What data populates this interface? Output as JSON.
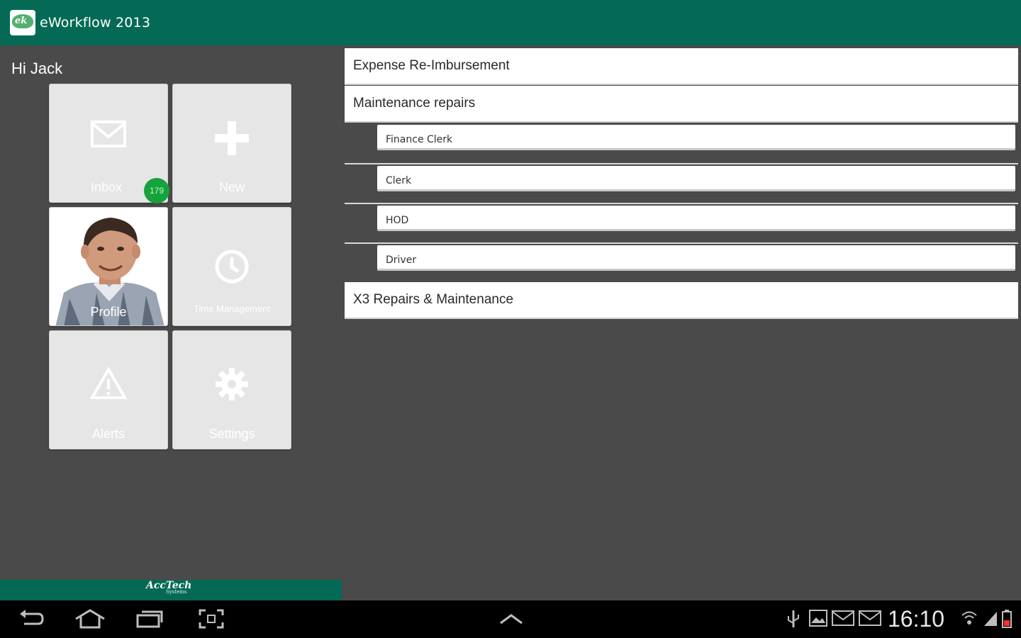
{
  "app": {
    "title": "eWorkflow 2013",
    "logo_text": "ek"
  },
  "greeting": "Hi Jack",
  "tiles": [
    {
      "id": "inbox",
      "label": "Inbox",
      "icon": "envelope-icon",
      "badge": "179"
    },
    {
      "id": "new",
      "label": "New",
      "icon": "plus-icon"
    },
    {
      "id": "profile",
      "label": "Profile",
      "icon": "profile-photo"
    },
    {
      "id": "time",
      "label": "Time Management",
      "icon": "clock-icon"
    },
    {
      "id": "alerts",
      "label": "Alerts",
      "icon": "warning-icon"
    },
    {
      "id": "settings",
      "label": "Settings",
      "icon": "gear-icon"
    }
  ],
  "brand": {
    "name": "AccTech",
    "sub": "Systems"
  },
  "workflows": [
    {
      "label": "Expense Re-Imbursement"
    },
    {
      "label": "Maintenance repairs",
      "children": [
        "Finance Clerk",
        "Clerk",
        "HOD",
        "Driver"
      ]
    },
    {
      "label": "X3 Repairs & Maintenance"
    }
  ],
  "status": {
    "time": "16:10"
  },
  "colors": {
    "primary": "#046a55",
    "background": "#4a4a4a",
    "badge": "#15a33b",
    "tile": "#e6e6e6"
  }
}
